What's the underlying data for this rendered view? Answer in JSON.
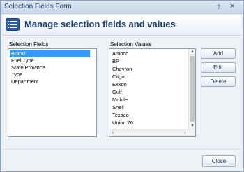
{
  "window": {
    "title": "Selection Fields Form"
  },
  "header": {
    "title": "Manage selection fields and values"
  },
  "fields": {
    "label": "Selection Fields",
    "items": [
      "Brand",
      "Fuel Type",
      "State/Province",
      "Type",
      "Department"
    ],
    "selected": "Brand"
  },
  "values": {
    "label": "Selection Values",
    "items": [
      "Amoco",
      "BP",
      "Chevron",
      "Citgo",
      "Exxon",
      "Gulf",
      "Mobile",
      "Shell",
      "Texaco",
      "Union 76"
    ]
  },
  "buttons": {
    "add": "Add",
    "edit": "Edit",
    "delete": "Delete",
    "close": "Close"
  },
  "colors": {
    "accent": "#1f3f77",
    "selection": "#3399ff"
  }
}
